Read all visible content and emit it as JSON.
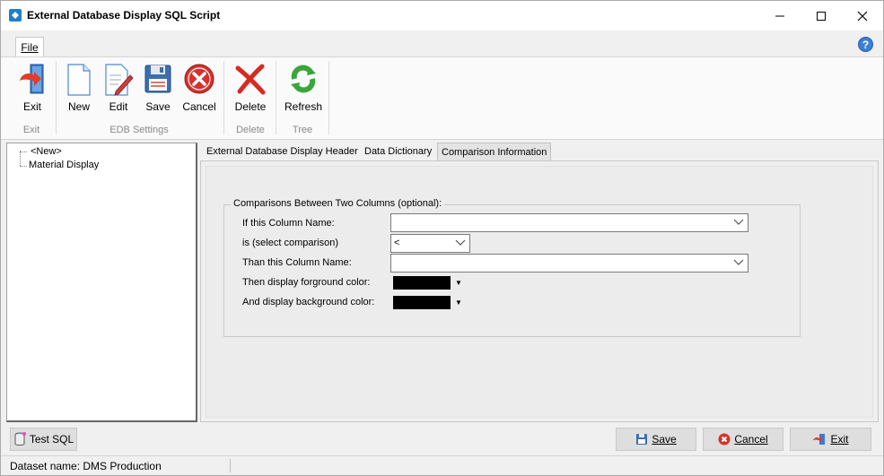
{
  "window": {
    "title": "External Database Display SQL Script",
    "minimize_icon": "minimize-icon",
    "maximize_icon": "maximize-icon",
    "close_icon": "close-icon"
  },
  "ribbon": {
    "tab_file": "File",
    "help": "?",
    "buttons": {
      "exit": "Exit",
      "new": "New",
      "edit": "Edit",
      "save": "Save",
      "cancel": "Cancel",
      "delete": "Delete",
      "refresh": "Refresh"
    },
    "groups": {
      "exit": "Exit",
      "edb_settings": "EDB Settings",
      "delete": "Delete",
      "tree": "Tree"
    }
  },
  "tree": {
    "items": [
      "<New>",
      "Material Display"
    ]
  },
  "tabs": [
    {
      "label": "External Database Display Header",
      "underline_char": "E"
    },
    {
      "label": "Data Dictionary",
      "underline_char": "D"
    },
    {
      "label": "Comparison Information",
      "underline_char": "C"
    }
  ],
  "comparison": {
    "group_title": "Comparisons Between Two Columns (optional):",
    "labels": {
      "if_column": "If this Column Name:",
      "comparison": "is (select comparison)",
      "than_column": "Than this Column Name:",
      "fg_color": "Then display forground color:",
      "bg_color": "And display background color:"
    },
    "values": {
      "if_column": "",
      "comparison": "<",
      "than_column": "",
      "fg_color": "#000000",
      "bg_color": "#000000"
    }
  },
  "footer": {
    "test_sql": "Test SQL",
    "save": "Save",
    "cancel": "Cancel",
    "exit": "Exit"
  },
  "status": {
    "dataset": "Dataset name:  DMS Production"
  }
}
